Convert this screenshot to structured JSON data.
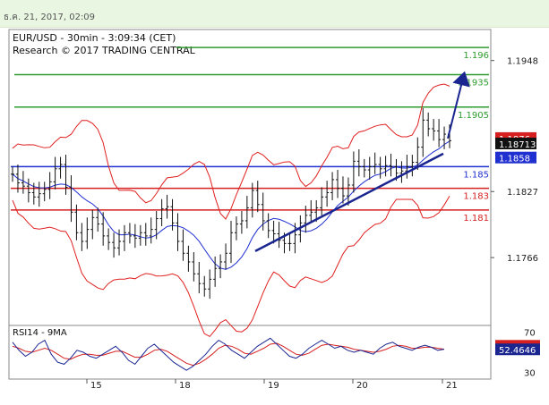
{
  "header": {
    "timestamp": "ธ.ค. 21, 2017, 02:09"
  },
  "chart_data": {
    "type": "line",
    "subtype": "ohlc-bars",
    "title": "EUR/USD - 30min - 3:09:34 (CET)",
    "subtitle": "Research © 2017 TRADING CENTRAL",
    "x_tick_labels": [
      "15",
      "18",
      "19",
      "20",
      "21"
    ],
    "y_ticks": [
      "1.1948",
      "1.1827",
      "1.1766"
    ],
    "ylim": [
      1.1705,
      1.1975
    ],
    "levels": [
      {
        "label": "1.196",
        "value": 1.196,
        "color": "#2e9b2e",
        "kind": "resistance"
      },
      {
        "label": "1.1935",
        "value": 1.1935,
        "color": "#2e9b2e",
        "kind": "resistance"
      },
      {
        "label": "1.1905",
        "value": 1.1905,
        "color": "#2e9b2e",
        "kind": "resistance"
      },
      {
        "label": "1.185",
        "value": 1.185,
        "color": "#1f2fd0",
        "kind": "pivot"
      },
      {
        "label": "1.183",
        "value": 1.183,
        "color": "#d62020",
        "kind": "support"
      },
      {
        "label": "1.181",
        "value": 1.181,
        "color": "#d62020",
        "kind": "support"
      }
    ],
    "price_badges": [
      {
        "label": "1.1876",
        "value": 1.1876,
        "color": "#d62020"
      },
      {
        "label": "1.18713",
        "value": 1.1871,
        "color": "#111111"
      },
      {
        "label": "1.1858",
        "value": 1.1858,
        "color": "#1f2fd0"
      }
    ],
    "price_series": [
      1.1843,
      1.1835,
      1.1832,
      1.1826,
      1.1822,
      1.1825,
      1.1829,
      1.1836,
      1.1848,
      1.1852,
      1.1831,
      1.1808,
      1.1789,
      1.1781,
      1.1792,
      1.1803,
      1.1797,
      1.1786,
      1.178,
      1.1775,
      1.1781,
      1.1789,
      1.1786,
      1.1784,
      1.1789,
      1.1786,
      1.1792,
      1.1802,
      1.1811,
      1.1813,
      1.1798,
      1.1781,
      1.177,
      1.1762,
      1.1751,
      1.1742,
      1.1737,
      1.1746,
      1.1756,
      1.1762,
      1.177,
      1.1789,
      1.1797,
      1.18,
      1.1812,
      1.1828,
      1.1815,
      1.18,
      1.1791,
      1.1788,
      1.1782,
      1.1779,
      1.1779,
      1.1787,
      1.1798,
      1.1805,
      1.1808,
      1.1812,
      1.1822,
      1.1826,
      1.1838,
      1.183,
      1.1823,
      1.1833,
      1.1855,
      1.185,
      1.1847,
      1.185,
      1.1852,
      1.1848,
      1.1851,
      1.185,
      1.1844,
      1.1846,
      1.185,
      1.1854,
      1.1868,
      1.1893,
      1.1885,
      1.1883,
      1.1875,
      1.188,
      1.1874
    ],
    "trend_line": {
      "from": [
        285,
        1.1772
      ],
      "to": [
        495,
        1.1862
      ],
      "color": "#1a2590"
    },
    "forecast_arrow": {
      "from": [
        500,
        1.1876
      ],
      "to": [
        518,
        1.1935
      ],
      "color": "#1a2590"
    },
    "indicator": {
      "name": "RSI14 - 9MA",
      "y_ticks": [
        "70",
        "30"
      ],
      "ylim": [
        25,
        75
      ],
      "badges": [
        {
          "label": "55.9948",
          "value": 55.99,
          "color": "#d62020"
        },
        {
          "label": "52.4646",
          "value": 52.46,
          "color": "#1a2590"
        }
      ],
      "rsi_series": [
        60,
        52,
        46,
        50,
        58,
        62,
        48,
        40,
        38,
        44,
        52,
        50,
        46,
        44,
        48,
        52,
        56,
        50,
        42,
        38,
        46,
        54,
        58,
        52,
        46,
        40,
        36,
        32,
        36,
        42,
        48,
        56,
        62,
        58,
        52,
        48,
        44,
        50,
        56,
        60,
        64,
        58,
        52,
        46,
        44,
        48,
        54,
        58,
        62,
        58,
        54,
        56,
        52,
        50,
        52,
        50,
        48,
        54,
        58,
        60,
        56,
        54,
        52,
        55,
        57,
        55,
        52,
        53
      ],
      "ma_series": [
        56,
        54,
        51,
        50,
        52,
        54,
        52,
        48,
        44,
        43,
        46,
        48,
        48,
        47,
        47,
        49,
        51,
        51,
        48,
        45,
        45,
        48,
        52,
        53,
        51,
        47,
        43,
        39,
        37,
        39,
        43,
        48,
        54,
        57,
        56,
        53,
        49,
        48,
        51,
        54,
        58,
        59,
        56,
        52,
        48,
        47,
        49,
        53,
        57,
        58,
        57,
        56,
        55,
        53,
        52,
        51,
        50,
        51,
        53,
        56,
        57,
        56,
        54,
        54,
        55,
        55,
        54,
        53
      ]
    }
  }
}
